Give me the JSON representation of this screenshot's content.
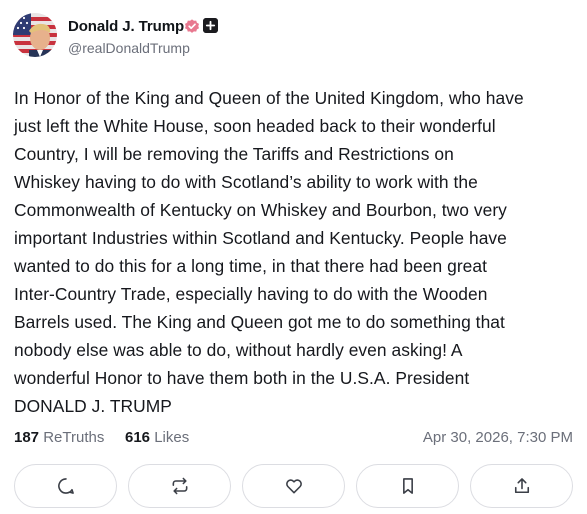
{
  "author": {
    "display_name": "Donald J. Trump",
    "handle": "@realDonaldTrump",
    "avatar_icon": "user-avatar",
    "verified_icon": "verified-badge-icon",
    "plus_icon": "plus-icon",
    "verified_color": "#e8788f"
  },
  "post": {
    "text": "In Honor of the King and Queen of the United Kingdom, who have\njust left the White House, soon headed back to their wonderful\nCountry, I will be removing the Tariffs and Restrictions on\nWhiskey having to do with Scotland’s ability to work with the\nCommonwealth of Kentucky on Whiskey and Bourbon, two very\nimportant Industries within Scotland and Kentucky. People have\nwanted to do this for a long time, in that there had been great\nInter-Country Trade, especially having to do with the Wooden\nBarrels used. The King and Queen got me to do something that\nnobody else was able to do, without hardly even asking! A\nwonderful Honor to have them both in the U.S.A.  President\nDONALD J. TRUMP"
  },
  "stats": {
    "retruths_count": "187",
    "retruths_label": "ReTruths",
    "likes_count": "616",
    "likes_label": "Likes",
    "timestamp": "Apr 30, 2026, 7:30 PM"
  },
  "actions": [
    {
      "name": "reply",
      "icon": "comment-icon"
    },
    {
      "name": "retruth",
      "icon": "repost-icon"
    },
    {
      "name": "like",
      "icon": "heart-icon"
    },
    {
      "name": "save",
      "icon": "bookmark-icon"
    },
    {
      "name": "share",
      "icon": "share-icon"
    }
  ]
}
